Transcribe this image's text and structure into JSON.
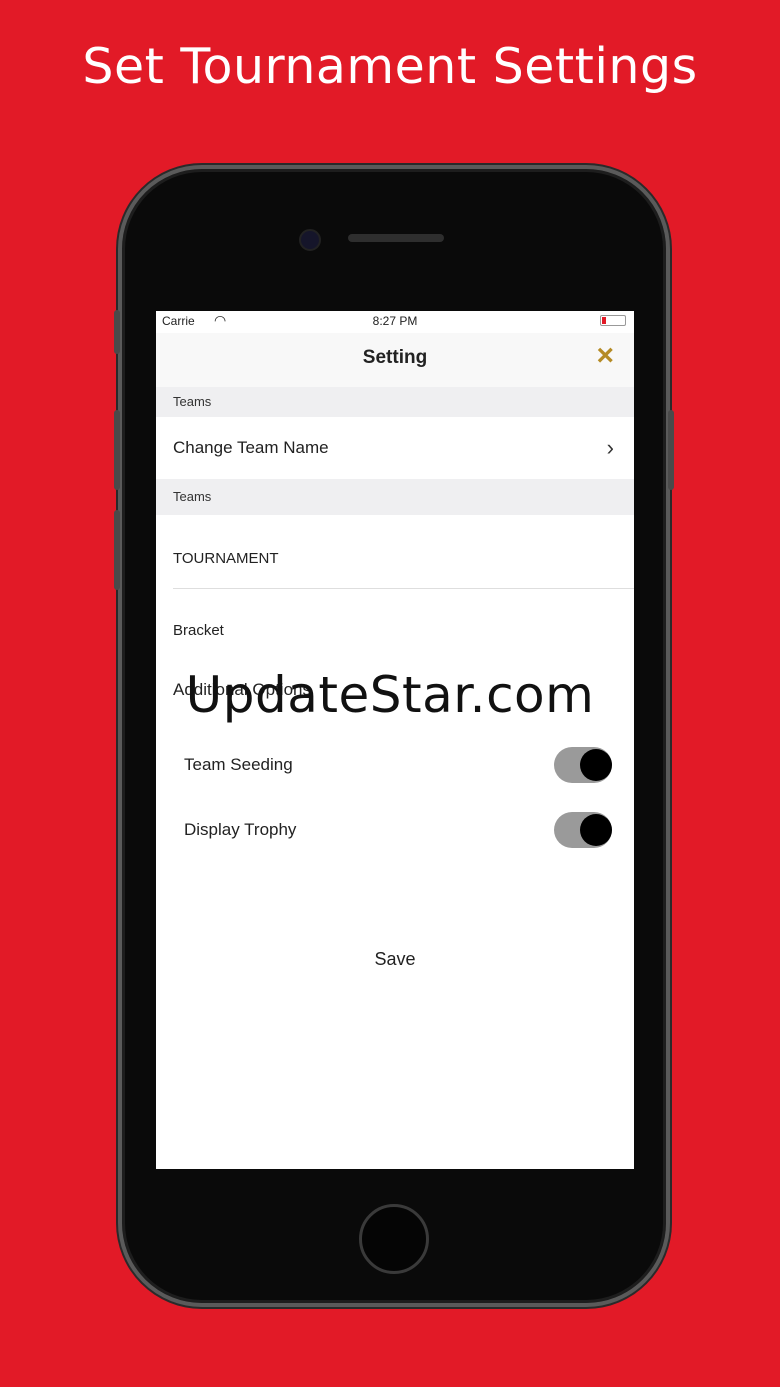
{
  "headline": "Set Tournament Settings",
  "status_bar": {
    "carrier": "Carrie",
    "time": "8:27 PM"
  },
  "nav": {
    "title": "Setting",
    "close_icon": "×"
  },
  "sections": {
    "teams_header_1": "Teams",
    "change_team_name": "Change Team Name",
    "chevron": "›",
    "teams_header_2": "Teams",
    "tournament": "TOURNAMENT",
    "bracket": "Bracket",
    "additional_options": "Additional Options"
  },
  "toggles": {
    "team_seeding": {
      "label": "Team Seeding",
      "on": true
    },
    "display_trophy": {
      "label": "Display Trophy",
      "on": true
    }
  },
  "save_label": "Save",
  "watermark": "UpdateStar.com",
  "colors": {
    "background": "#e21a27",
    "close_icon": "#b58b25"
  }
}
